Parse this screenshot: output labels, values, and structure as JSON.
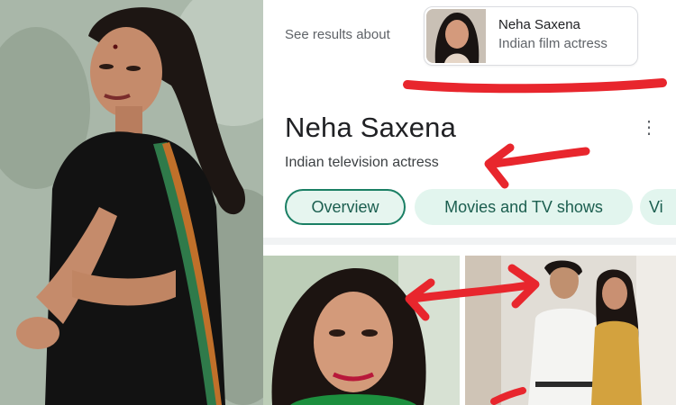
{
  "search_panel": {
    "see_results_label": "See results about",
    "result_card": {
      "name": "Neha Saxena",
      "description": "Indian film actress"
    },
    "entity": {
      "title": "Neha Saxena",
      "subtitle": "Indian television actress",
      "more_icon": "more-vertical-icon"
    },
    "tabs": [
      {
        "label": "Overview",
        "active": true
      },
      {
        "label": "Movies and TV shows",
        "active": false
      },
      {
        "label": "Vi",
        "active": false
      }
    ]
  },
  "colors": {
    "annotation_red": "#e8262d",
    "chip_bg": "#e2f5ee",
    "chip_text": "#1b5e4f",
    "chip_border_active": "#1a7f64"
  }
}
